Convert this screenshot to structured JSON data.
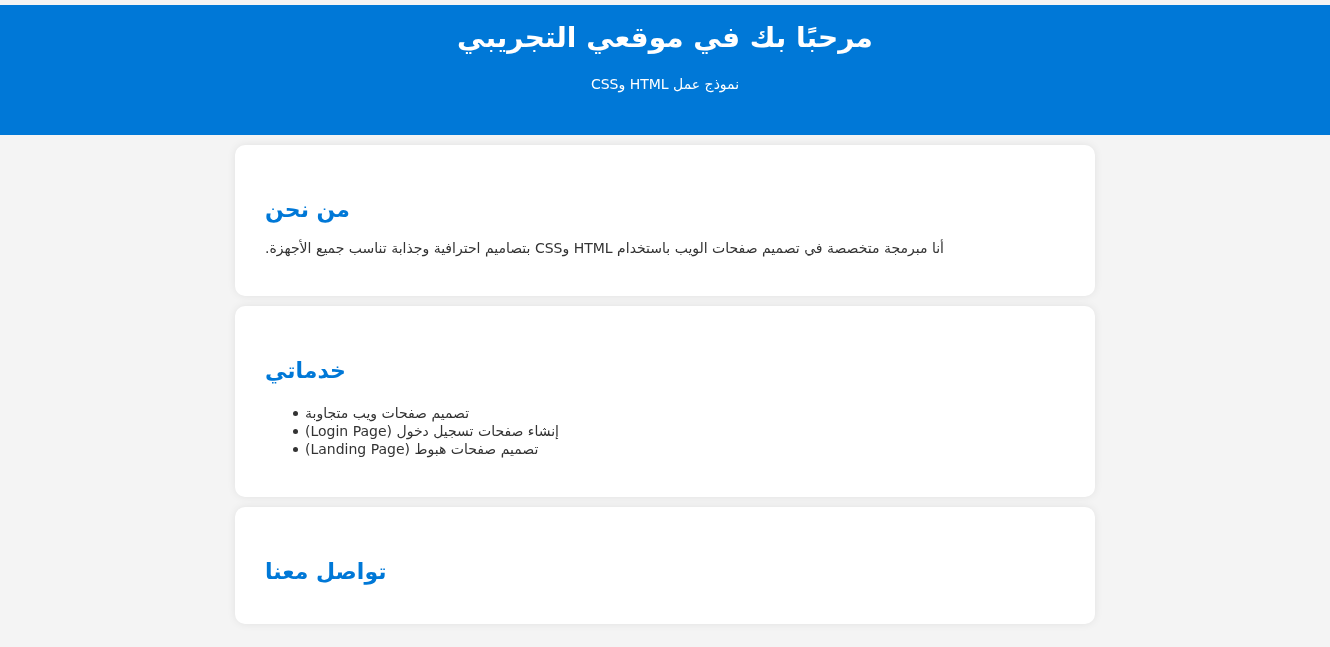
{
  "header": {
    "title": "مرحبًا بك في موقعي التجريبي",
    "subtitle": "نموذج عمل HTML وCSS"
  },
  "sections": [
    {
      "kind": "text",
      "heading": "من نحن",
      "paragraph": "أنا مبرمجة متخصصة في تصميم صفحات الويب باستخدام HTML وCSS بتصاميم احترافية وجذابة تناسب جميع الأجهزة."
    },
    {
      "kind": "list",
      "heading": "خدماتي",
      "items": [
        "تصميم صفحات ويب متجاوبة",
        "إنشاء صفحات تسجيل دخول (Login Page)",
        "تصميم صفحات هبوط (Landing Page)"
      ]
    },
    {
      "kind": "text",
      "heading": "تواصل معنا"
    }
  ]
}
